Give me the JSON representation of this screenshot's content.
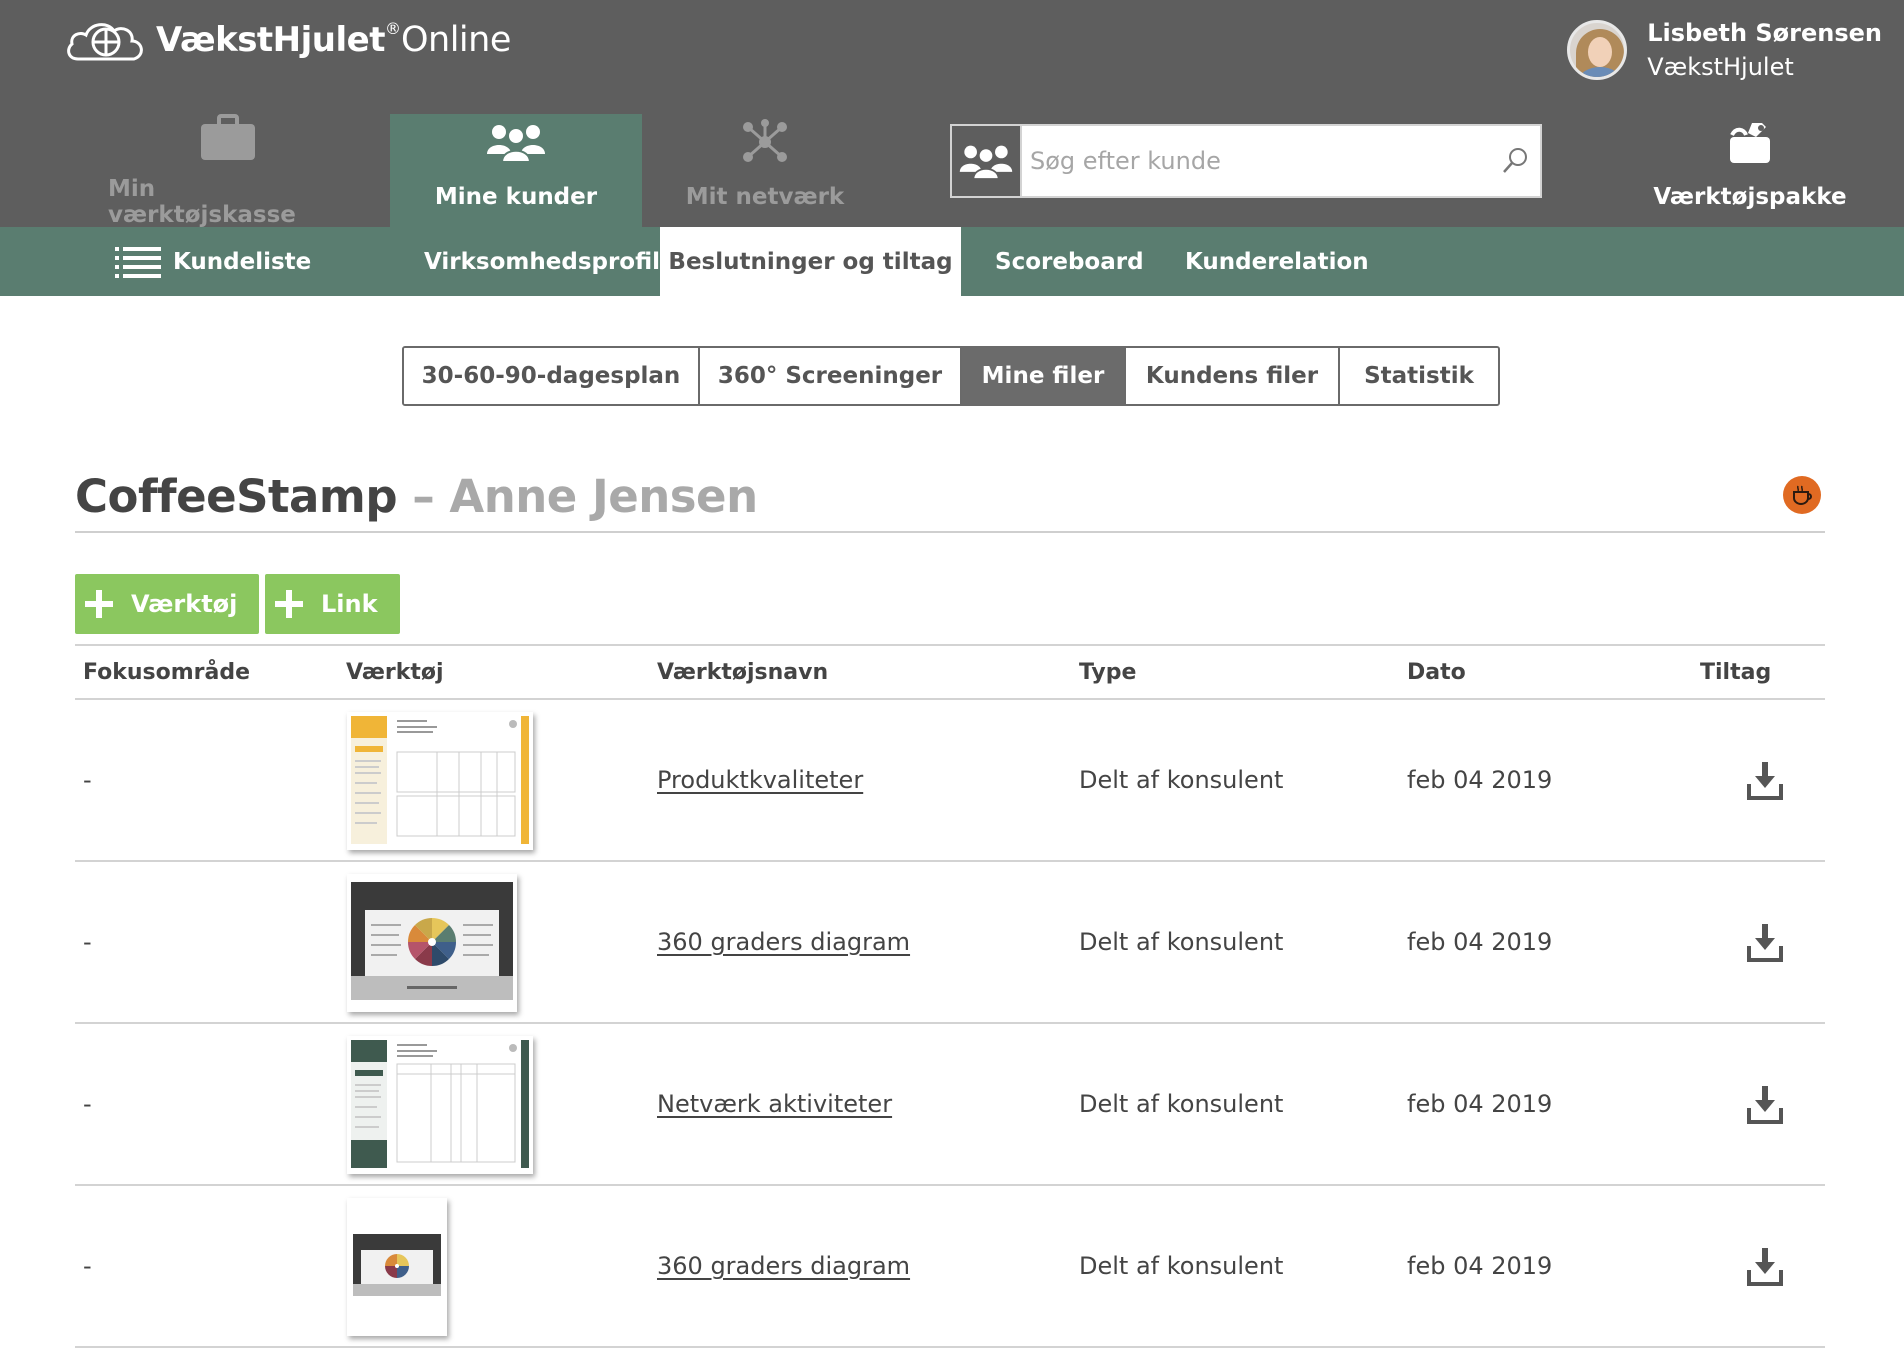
{
  "header": {
    "logo_brand": "VækstHjulet",
    "logo_reg": "®",
    "logo_suffix": "Online",
    "user_name": "Lisbeth Sørensen",
    "user_org": "VækstHjulet"
  },
  "nav": {
    "toolbox": "Min værktøjskasse",
    "customers": "Mine kunder",
    "network": "Mit netværk",
    "toolpack": "Værktøjspakke"
  },
  "search": {
    "placeholder": "Søg efter kunde"
  },
  "subnav": {
    "customer_list": "Kundeliste",
    "company_profile": "Virksomhedsprofil",
    "decisions": "Beslutninger og tiltag",
    "scoreboard": "Scoreboard",
    "relation": "Kunderelation"
  },
  "tabs": [
    "30-60-90-dagesplan",
    "360° Screeninger",
    "Mine filer",
    "Kundens filer",
    "Statistik"
  ],
  "page": {
    "company": "CoffeeStamp",
    "separator": " – ",
    "person": "Anne Jensen"
  },
  "buttons": {
    "tool": "Værktøj",
    "link": "Link"
  },
  "table": {
    "headers": {
      "focus": "Fokusområde",
      "tool": "Værktøj",
      "tool_name": "Værktøjsnavn",
      "type": "Type",
      "date": "Dato",
      "action": "Tiltag"
    },
    "rows": [
      {
        "focus": "-",
        "name": "Produktkvaliteter",
        "type": "Delt af konsulent",
        "date": "feb 04 2019"
      },
      {
        "focus": "-",
        "name": "360 graders diagram",
        "type": "Delt af konsulent",
        "date": "feb 04 2019"
      },
      {
        "focus": "-",
        "name": "Netværk aktiviteter",
        "type": "Delt af konsulent",
        "date": "feb 04 2019"
      },
      {
        "focus": "-",
        "name": "360 graders diagram",
        "type": "Delt af konsulent",
        "date": "feb 04 2019"
      }
    ]
  },
  "colors": {
    "header_bg": "#5e5e5e",
    "accent_green": "#5a7d70",
    "button_green": "#8bc75f",
    "company_logo": "#e06a22"
  }
}
